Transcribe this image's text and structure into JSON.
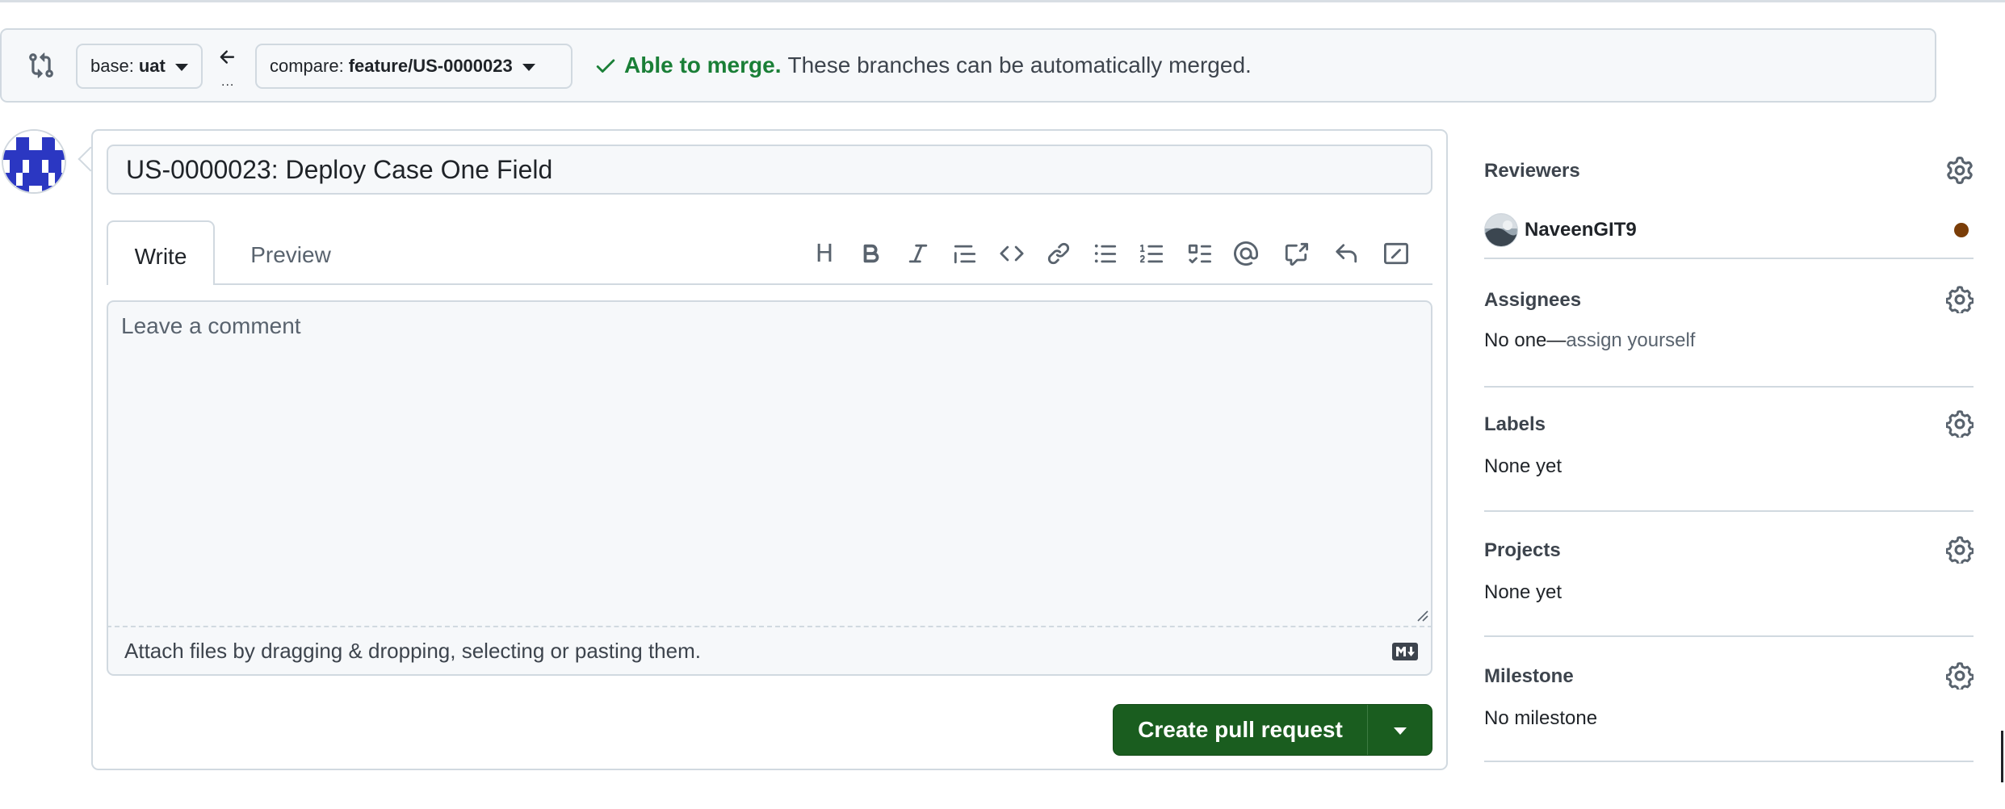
{
  "compare_bar": {
    "base_label": "base:",
    "base_value": "uat",
    "arrow_dots": "...",
    "compare_label": "compare:",
    "compare_value": "feature/US-0000023",
    "merge_status": "Able to merge.",
    "merge_detail": "These branches can be automatically merged.",
    "status_color": "#1a7f37"
  },
  "pull_request": {
    "title_value": "US-0000023: Deploy Case One Field",
    "tabs": [
      {
        "label": "Write",
        "active": true
      },
      {
        "label": "Preview",
        "active": false
      }
    ],
    "toolbar_icons": [
      "heading-icon",
      "bold-icon",
      "italic-icon",
      "quote-icon",
      "code-icon",
      "link-icon",
      "unordered-list-icon",
      "ordered-list-icon",
      "task-list-icon",
      "mention-icon",
      "cross-reference-icon",
      "saved-reply-icon",
      "slash-command-icon"
    ],
    "comment_placeholder": "Leave a comment",
    "attach_text": "Attach files by dragging & dropping, selecting or pasting them.",
    "create_button": "Create pull request",
    "button_color": "#1a5d1f"
  },
  "sidebar": {
    "reviewers": {
      "title": "Reviewers",
      "name": "NaveenGIT9",
      "status_color": "#7a3d08"
    },
    "assignees": {
      "title": "Assignees",
      "value_prefix": "No one—",
      "value_link": "assign yourself"
    },
    "labels": {
      "title": "Labels",
      "value": "None yet"
    },
    "projects": {
      "title": "Projects",
      "value": "None yet"
    },
    "milestone": {
      "title": "Milestone",
      "value": "No milestone"
    }
  }
}
